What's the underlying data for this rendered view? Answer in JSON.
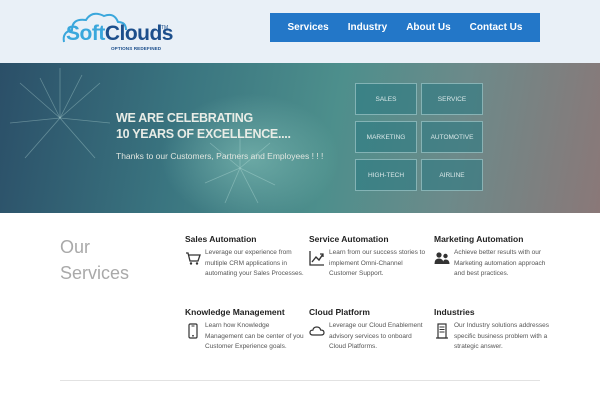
{
  "logo": {
    "soft": "Soft",
    "clouds": "Clouds",
    "tm": "TM",
    "tagline": "OPTIONS REDEFINED"
  },
  "nav": {
    "items": [
      "Services",
      "Industry",
      "About Us",
      "Contact Us"
    ]
  },
  "hero": {
    "headline_line1": "WE ARE CELEBRATING",
    "headline_line2": "10 YEARS OF EXCELLENCE....",
    "subline": "Thanks to our Customers, Partners and Employees ! ! !",
    "tiles": [
      "SALES",
      "SERVICE",
      "MARKETING",
      "AUTOMOTIVE",
      "HIGH-TECH",
      "AIRLINE"
    ]
  },
  "services": {
    "heading_line1": "Our",
    "heading_line2": "Services",
    "items": [
      {
        "title": "Sales Automation",
        "icon": "shopping-cart-icon",
        "desc": "Leverage our experience from multiple CRM applications in automating your Sales Processes."
      },
      {
        "title": "Service Automation",
        "icon": "trend-chart-icon",
        "desc": "Learn from our success stories to implement Omni-Channel Customer Support."
      },
      {
        "title": "Marketing Automation",
        "icon": "users-icon",
        "desc": "Achieve better results with our Marketing automation approach and best practices."
      },
      {
        "title": "Knowledge Management",
        "icon": "mobile-phone-icon",
        "desc": "Learn how Knowledge Management can be center of you Customer Experience goals."
      },
      {
        "title": "Cloud Platform",
        "icon": "cloud-icon",
        "desc": "Leverage our Cloud Enablement advisory services to onboard Cloud Platforms."
      },
      {
        "title": "Industries",
        "icon": "server-icon",
        "desc": "Our Industry solutions addresses specific business problem with a strategic answer."
      }
    ]
  }
}
